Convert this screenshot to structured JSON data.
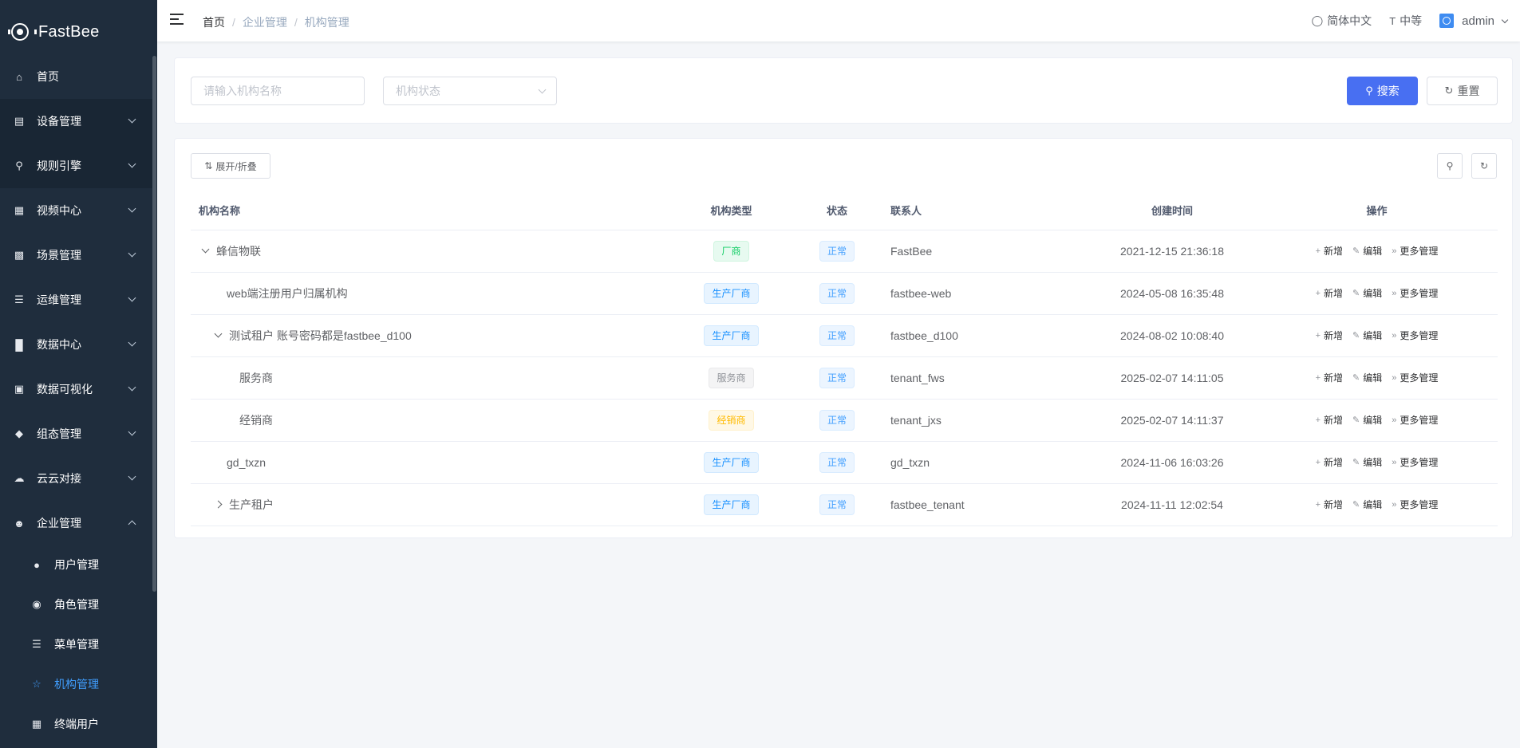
{
  "app": {
    "title": "FastBee"
  },
  "sidebar": {
    "items": [
      {
        "label": "首页",
        "icon": "home-icon"
      },
      {
        "label": "设备管理",
        "icon": "device-icon"
      },
      {
        "label": "规则引擎",
        "icon": "rule-icon"
      },
      {
        "label": "视频中心",
        "icon": "video-icon"
      },
      {
        "label": "场景管理",
        "icon": "scene-icon"
      },
      {
        "label": "运维管理",
        "icon": "ops-icon"
      },
      {
        "label": "数据中心",
        "icon": "data-icon"
      },
      {
        "label": "数据可视化",
        "icon": "visual-icon"
      },
      {
        "label": "组态管理",
        "icon": "layers-icon"
      },
      {
        "label": "云云对接",
        "icon": "cloud-icon"
      },
      {
        "label": "企业管理",
        "icon": "enterprise-icon"
      }
    ],
    "sub_items": [
      {
        "label": "用户管理",
        "icon": "user-icon"
      },
      {
        "label": "角色管理",
        "icon": "role-icon"
      },
      {
        "label": "菜单管理",
        "icon": "menu-tree-icon"
      },
      {
        "label": "机构管理",
        "icon": "org-icon",
        "active": true
      },
      {
        "label": "终端用户",
        "icon": "terminal-user-icon"
      }
    ]
  },
  "header": {
    "breadcrumb": [
      "首页",
      "企业管理",
      "机构管理"
    ],
    "language": "简体中文",
    "size": "中等",
    "user": "admin"
  },
  "search": {
    "name_placeholder": "请输入机构名称",
    "status_placeholder": "机构状态",
    "search_label": "搜索",
    "reset_label": "重置"
  },
  "toolbar": {
    "expand_label": "展开/折叠"
  },
  "table": {
    "columns": [
      "机构名称",
      "机构类型",
      "状态",
      "联系人",
      "创建时间",
      "操作"
    ],
    "actions": {
      "add": "新增",
      "edit": "编辑",
      "more": "更多管理"
    },
    "rows": [
      {
        "name": "蜂信物联",
        "type": "厂商",
        "type_style": "success",
        "status": "正常",
        "contact": "FastBee",
        "created": "2021-12-15 21:36:18"
      },
      {
        "name": "web端注册用户归属机构",
        "type": "生产厂商",
        "type_style": "primary",
        "status": "正常",
        "contact": "fastbee-web",
        "created": "2024-05-08 16:35:48"
      },
      {
        "name": "测试租户 账号密码都是fastbee_d100",
        "type": "生产厂商",
        "type_style": "primary",
        "status": "正常",
        "contact": "fastbee_d100",
        "created": "2024-08-02 10:08:40"
      },
      {
        "name": "服务商",
        "type": "服务商",
        "type_style": "info",
        "status": "正常",
        "contact": "tenant_fws",
        "created": "2025-02-07 14:11:05"
      },
      {
        "name": "经销商",
        "type": "经销商",
        "type_style": "warning",
        "status": "正常",
        "contact": "tenant_jxs",
        "created": "2025-02-07 14:11:37"
      },
      {
        "name": "gd_txzn",
        "type": "生产厂商",
        "type_style": "primary",
        "status": "正常",
        "contact": "gd_txzn",
        "created": "2024-11-06 16:03:26"
      },
      {
        "name": "生产租户",
        "type": "生产厂商",
        "type_style": "primary",
        "status": "正常",
        "contact": "fastbee_tenant",
        "created": "2024-11-11 12:02:54"
      }
    ]
  },
  "colors": {
    "sidebar_bg": "#1f2d3d",
    "primary": "#486ff2",
    "active_menu": "#409eff"
  }
}
